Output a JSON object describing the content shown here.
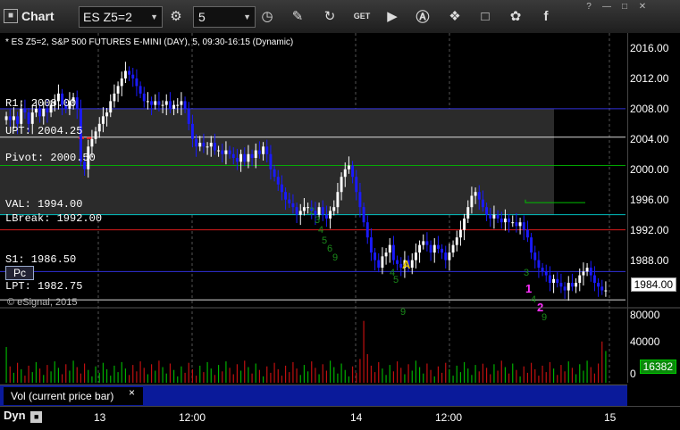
{
  "toolbar": {
    "app_title": "Chart",
    "symbol": "ES Z5=2",
    "interval": "5",
    "icons": [
      "chart-icon",
      "dropdown-icon",
      "settings-icon",
      "clock-icon",
      "pencil-icon",
      "refresh-icon",
      "get-icon",
      "play-icon",
      "a-icon",
      "tag-icon",
      "comment-icon",
      "twitter-icon",
      "facebook-icon"
    ],
    "window_buttons": [
      "?",
      "—",
      "□",
      "✕"
    ]
  },
  "chart_header": "* ES Z5=2, S&P 500 FUTURES E-MINI (DAY), 5, 09:30-16:15 (Dynamic)",
  "price_axis": [
    "2016.00",
    "2012.00",
    "2008.00",
    "2004.00",
    "2000.00",
    "1996.00",
    "1992.00",
    "1988.00"
  ],
  "current_price": "1984.00",
  "levels": [
    {
      "label": "R1: 2008.00",
      "color": "#3a3aff"
    },
    {
      "label": "UPT: 2004.25",
      "color": "#ffffff"
    },
    {
      "label": "Pivot: 2000.50",
      "color": "#00c000"
    },
    {
      "label": "VAL: 1994.00",
      "color": "#00e0e0"
    },
    {
      "label": "LBreak: 1992.00",
      "color": "#ff2020"
    },
    {
      "label": "S1: 1986.50",
      "color": "#3a3aff"
    },
    {
      "label": "LPT: 1982.75",
      "color": "#ffffff"
    }
  ],
  "pc_badge": "Pc",
  "copyright": "© eSignal, 2015",
  "volume_axis": [
    "80000",
    "40000",
    "0"
  ],
  "current_volume": "16382",
  "volume_label": "Vol (current price bar)",
  "close_x": "×",
  "time_axis": [
    "13",
    "12:00",
    "14",
    "12:00",
    "15"
  ],
  "dyn_label": "Dyn",
  "markers": {
    "a": "A",
    "one": "1",
    "two": "2"
  },
  "colors": {
    "up": "#ffffff",
    "down": "#1a1aff",
    "bg": "#000000",
    "value_area": "#2b2b2b",
    "volume_up": "#00b000",
    "volume_down": "#c01010",
    "panel_blue": "#0a1a9a"
  },
  "chart_data": {
    "type": "candlestick",
    "title": "* ES Z5=2, S&P 500 FUTURES E-MINI (DAY), 5, 09:30-16:15 (Dynamic)",
    "price_range": [
      1981.0,
      2018.0
    ],
    "volume_range": [
      0,
      90000
    ],
    "sessions": [
      "13",
      "14",
      "15"
    ],
    "close_path": [
      2007,
      2006.5,
      2007,
      2006,
      2008,
      2007.5,
      2006,
      2007.5,
      2008,
      2007,
      2008,
      2007.5,
      2008.5,
      2009,
      2010,
      2008.5,
      2008,
      2009,
      2009.5,
      2008,
      2001,
      2000,
      2003,
      2004,
      2005,
      2006,
      2007,
      2007.5,
      2009,
      2010,
      2011,
      2012,
      2013,
      2012.5,
      2012,
      2011,
      2010,
      2009,
      2009,
      2008.5,
      2009,
      2008.5,
      2008.5,
      2009,
      2008,
      2008.5,
      2008.5,
      2009,
      2008,
      2006,
      2004,
      2003,
      2003.5,
      2003,
      2003,
      2003.5,
      2002.5,
      2002.5,
      2002,
      2002.5,
      2002,
      2001.5,
      2001,
      2002,
      2001,
      2002,
      2001.5,
      2002.5,
      2002,
      2003,
      2002,
      2000,
      1999,
      1998,
      1997,
      1996,
      1995.5,
      1995,
      1994,
      1994.5,
      1995,
      1995,
      1994.5,
      1994,
      1995,
      1994,
      1993.5,
      1994.5,
      1995,
      1997,
      1999,
      2000,
      2000.5,
      1999,
      1997,
      1995,
      1993,
      1991,
      1989,
      1988,
      1987,
      1988.5,
      1989,
      1990,
      1988,
      1987.5,
      1987,
      1988,
      1987,
      1988,
      1989,
      1990,
      1990.5,
      1990,
      1989,
      1990,
      1989.5,
      1989,
      1988,
      1989,
      1990,
      1991,
      1992,
      1993.5,
      1995,
      1996.5,
      1997,
      1996,
      1995,
      1994,
      1993.5,
      1994,
      1993.5,
      1993,
      1993.5,
      1993,
      1993,
      1992.5,
      1993,
      1992,
      1991,
      1989,
      1988,
      1987,
      1986.5,
      1986,
      1985,
      1985.5,
      1985,
      1984.5,
      1984,
      1985,
      1984.5,
      1985,
      1986,
      1986.5,
      1987,
      1986,
      1985,
      1984.5,
      1984,
      1984
    ],
    "volume_peaks": [
      {
        "session": "14",
        "approx": 78000
      },
      {
        "session": "15",
        "approx": 52000
      }
    ]
  }
}
